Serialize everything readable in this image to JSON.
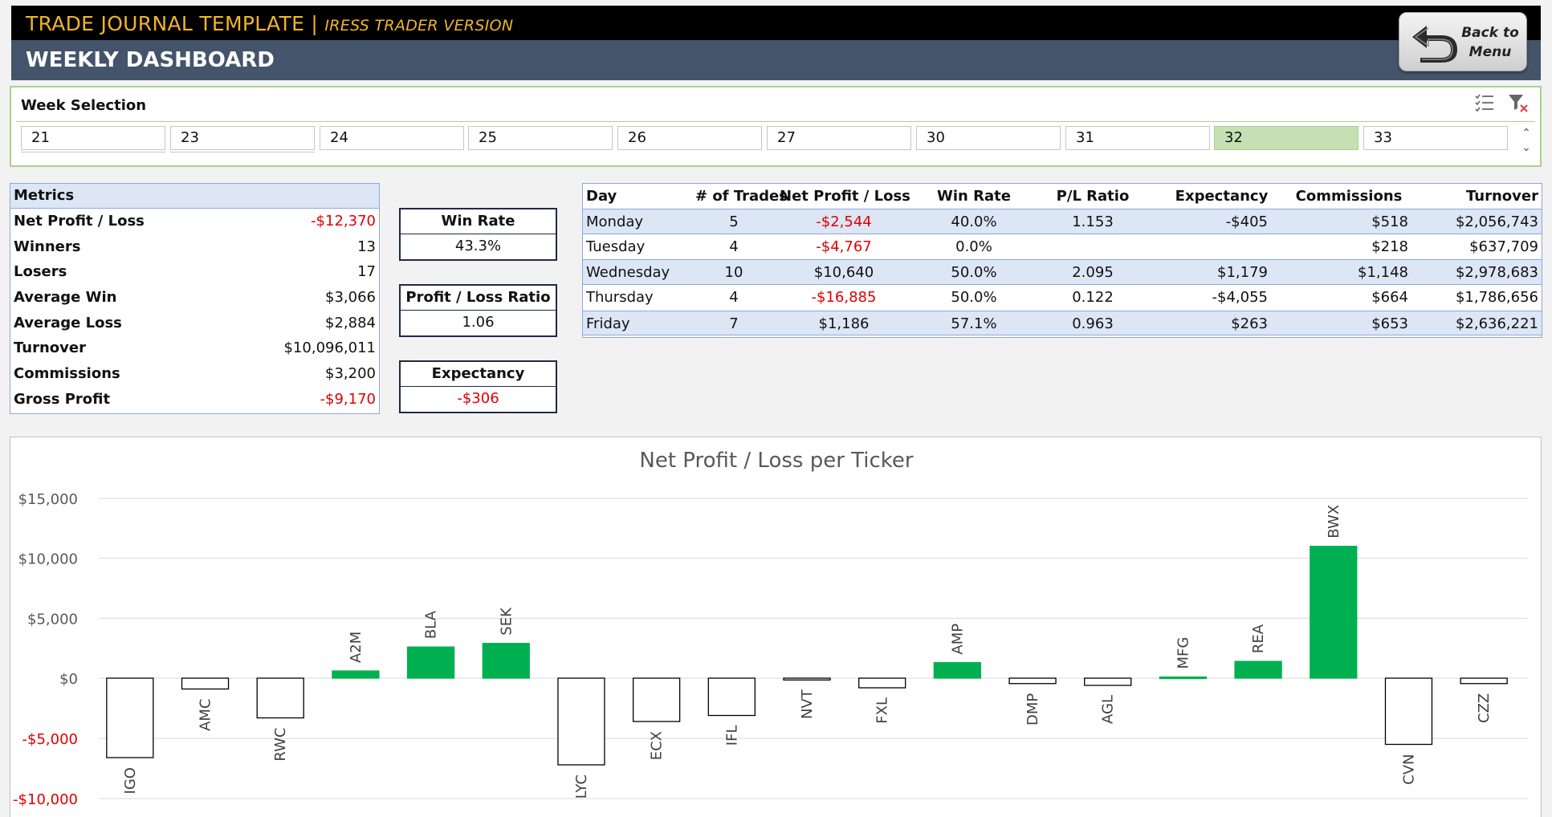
{
  "header": {
    "title_main": "TRADE JOURNAL TEMPLATE | ",
    "title_sub": "IRESS TRADER VERSION",
    "page_title": "WEEKLY DASHBOARD",
    "back_label_line1": "Back to",
    "back_label_line2": "Menu"
  },
  "slicer": {
    "title": "Week Selection",
    "weeks": [
      "21",
      "23",
      "24",
      "25",
      "26",
      "27",
      "30",
      "31",
      "32",
      "33"
    ],
    "selected": "32",
    "icons": [
      "multi-select-icon",
      "clear-filter-icon"
    ]
  },
  "metrics": {
    "header": "Metrics",
    "rows": [
      {
        "label": "Net Profit / Loss",
        "value": "-$12,370",
        "negative": true
      },
      {
        "label": "Winners",
        "value": "13",
        "negative": false
      },
      {
        "label": "Losers",
        "value": "17",
        "negative": false
      },
      {
        "label": "Average Win",
        "value": "$3,066",
        "negative": false
      },
      {
        "label": "Average Loss",
        "value": "$2,884",
        "negative": false
      },
      {
        "label": "Turnover",
        "value": "$10,096,011",
        "negative": false
      },
      {
        "label": "Commissions",
        "value": "$3,200",
        "negative": false
      },
      {
        "label": "Gross Profit",
        "value": "-$9,170",
        "negative": true
      }
    ]
  },
  "kpis": {
    "win_rate": {
      "title": "Win Rate",
      "value": "43.3%"
    },
    "pl_ratio": {
      "title": "Profit / Loss Ratio",
      "value": "1.06"
    },
    "expectancy": {
      "title": "Expectancy",
      "value": "-$306"
    }
  },
  "days": {
    "headers": [
      "Day",
      "# of Trades",
      "Net Profit / Loss",
      "Win Rate",
      "P/L Ratio",
      "Expectancy",
      "Commissions",
      "Turnover"
    ],
    "rows": [
      {
        "day": "Monday",
        "trades": "5",
        "net": "-$2,544",
        "net_negative": true,
        "win_rate": "40.0%",
        "pl_ratio": "1.153",
        "expectancy": "-$405",
        "commissions": "$518",
        "turnover": "$2,056,743"
      },
      {
        "day": "Tuesday",
        "trades": "4",
        "net": "-$4,767",
        "net_negative": true,
        "win_rate": "0.0%",
        "pl_ratio": "",
        "expectancy": "",
        "commissions": "$218",
        "turnover": "$637,709"
      },
      {
        "day": "Wednesday",
        "trades": "10",
        "net": "$10,640",
        "net_negative": false,
        "win_rate": "50.0%",
        "pl_ratio": "2.095",
        "expectancy": "$1,179",
        "commissions": "$1,148",
        "turnover": "$2,978,683"
      },
      {
        "day": "Thursday",
        "trades": "4",
        "net": "-$16,885",
        "net_negative": true,
        "win_rate": "50.0%",
        "pl_ratio": "0.122",
        "expectancy": "-$4,055",
        "commissions": "$664",
        "turnover": "$1,786,656"
      },
      {
        "day": "Friday",
        "trades": "7",
        "net": "$1,186",
        "net_negative": false,
        "win_rate": "57.1%",
        "pl_ratio": "0.963",
        "expectancy": "$263",
        "commissions": "$653",
        "turnover": "$2,636,221"
      }
    ]
  },
  "colors": {
    "header_black": "#000000",
    "header_slate": "#44546a",
    "title_gold": "#f0b429",
    "positive_bar": "#00b050",
    "negative_text": "#e00000",
    "slicer_selected": "#c6e0b4",
    "table_band": "#dce6f5"
  },
  "chart_data": {
    "type": "bar",
    "title": "Net Profit / Loss per Ticker",
    "categories": [
      "IGO",
      "AMC",
      "RWC",
      "A2M",
      "BLA",
      "SEK",
      "LYC",
      "ECX",
      "IFL",
      "NVT",
      "FXL",
      "AMP",
      "DMP",
      "AGL",
      "MFG",
      "REA",
      "BWX",
      "CVN",
      "CZZ"
    ],
    "values": [
      -6600,
      -900,
      -3300,
      600,
      2600,
      2900,
      -7200,
      -3600,
      -3100,
      -150,
      -800,
      1300,
      -450,
      -600,
      100,
      1400,
      11000,
      -5500,
      -450
    ],
    "ylim": [
      -10000,
      15000
    ],
    "yticks": [
      {
        "value": 15000,
        "label": "$15,000",
        "negative": false
      },
      {
        "value": 10000,
        "label": "$10,000",
        "negative": false
      },
      {
        "value": 5000,
        "label": "$5,000",
        "negative": false
      },
      {
        "value": 0,
        "label": "$0",
        "negative": false
      },
      {
        "value": -5000,
        "label": "-$5,000",
        "negative": true
      },
      {
        "value": -10000,
        "label": "-$10,000",
        "negative": true
      }
    ],
    "grid": true,
    "positive_color": "#00b050",
    "negative_color": "#ffffff"
  }
}
